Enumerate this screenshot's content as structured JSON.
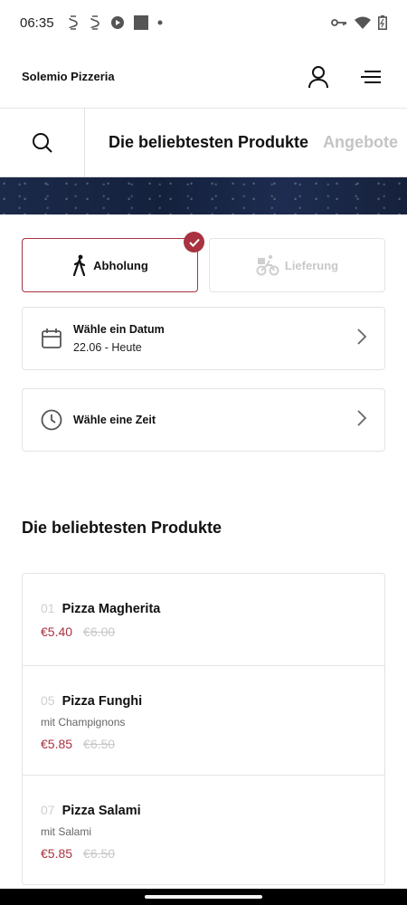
{
  "status_bar": {
    "time": "06:35",
    "left_icons": [
      "s-circle-icon",
      "s-circle-icon",
      "media-icon",
      "square-icon",
      "dot-icon"
    ],
    "right_icons": [
      "key-icon",
      "wifi-icon",
      "battery-icon"
    ]
  },
  "header": {
    "brand": "Solemio Pizzeria",
    "account_icon": "user-icon",
    "menu_icon": "menu-icon"
  },
  "tabs": {
    "search_icon": "search-icon",
    "items": [
      {
        "label": "Die beliebtesten Produkte",
        "active": true
      },
      {
        "label": "Angebote",
        "active": false
      }
    ]
  },
  "mode": {
    "pickup": {
      "label": "Abholung",
      "selected": true,
      "icon": "walk-icon"
    },
    "delivery": {
      "label": "Lieferung",
      "selected": false,
      "icon": "bike-icon"
    }
  },
  "date_picker": {
    "title": "Wähle ein Datum",
    "value": "22.06 - Heute",
    "icon": "calendar-icon"
  },
  "time_picker": {
    "title": "Wähle eine Zeit",
    "icon": "clock-icon"
  },
  "section": {
    "title": "Die beliebtesten Produkte"
  },
  "products": [
    {
      "num": "01",
      "name": "Pizza Magherita",
      "desc": "",
      "price": "€5.40",
      "old_price": "€6.00"
    },
    {
      "num": "05",
      "name": "Pizza Funghi",
      "desc": "mit Champignons",
      "price": "€5.85",
      "old_price": "€6.50"
    },
    {
      "num": "07",
      "name": "Pizza Salami",
      "desc": "mit Salami",
      "price": "€5.85",
      "old_price": "€6.50"
    }
  ],
  "colors": {
    "accent": "#a83241",
    "muted": "#c8c8c8"
  }
}
